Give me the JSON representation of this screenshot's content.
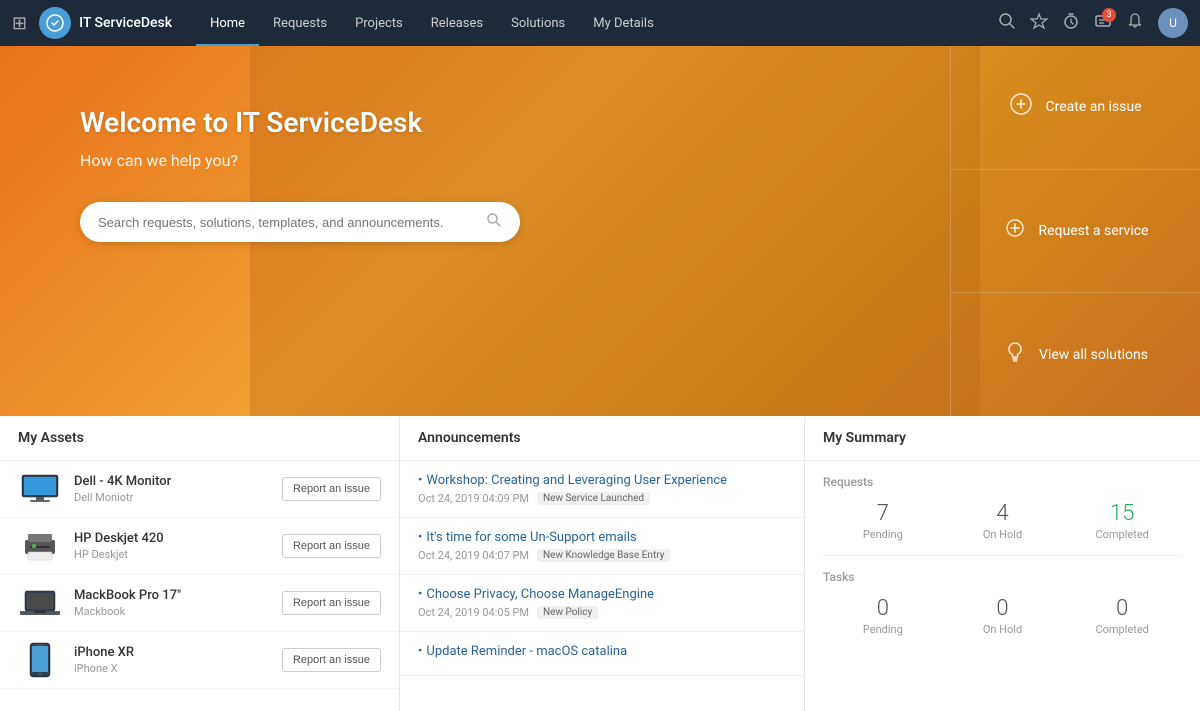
{
  "topnav": {
    "app_name": "IT ServiceDesk",
    "menu_items": [
      {
        "label": "Home",
        "active": true
      },
      {
        "label": "Requests",
        "active": false
      },
      {
        "label": "Projects",
        "active": false
      },
      {
        "label": "Releases",
        "active": false
      },
      {
        "label": "Solutions",
        "active": false
      },
      {
        "label": "My Details",
        "active": false
      }
    ],
    "notification_count": "3"
  },
  "hero": {
    "title": "Welcome to IT ServiceDesk",
    "subtitle": "How can we help you?",
    "search_placeholder": "Search requests, solutions, templates, and announcements.",
    "actions": [
      {
        "label": "Create an issue",
        "icon": "⊙"
      },
      {
        "label": "Request a service",
        "icon": "⊕"
      },
      {
        "label": "View all solutions",
        "icon": "💡"
      }
    ]
  },
  "my_assets": {
    "title": "My Assets",
    "items": [
      {
        "name": "Dell - 4K Monitor",
        "sub": "Dell Moniotr",
        "icon_type": "monitor"
      },
      {
        "name": "HP Deskjet 420",
        "sub": "HP Deskjet",
        "icon_type": "printer"
      },
      {
        "name": "MackBook Pro 17\"",
        "sub": "Mackbook",
        "icon_type": "laptop"
      },
      {
        "name": "iPhone XR",
        "sub": "iPhone X",
        "icon_type": "phone"
      }
    ],
    "report_button_label": "Report an issue"
  },
  "announcements": {
    "title": "Announcements",
    "items": [
      {
        "title": "Workshop: Creating and Leveraging User Experience",
        "date": "Oct 24, 2019 04:09 PM",
        "tag": "New Service Launched"
      },
      {
        "title": "It's time for some Un-Support emails",
        "date": "Oct 24, 2019 04:07 PM",
        "tag": "New Knowledge Base Entry"
      },
      {
        "title": "Choose Privacy, Choose ManageEngine",
        "date": "Oct 24, 2019 04:05 PM",
        "tag": "New Policy"
      },
      {
        "title": "Update Reminder - macOS catalina",
        "date": "",
        "tag": ""
      }
    ]
  },
  "my_summary": {
    "title": "My Summary",
    "requests_label": "Requests",
    "tasks_label": "Tasks",
    "requests": {
      "pending": 7,
      "on_hold": 4,
      "completed": 15
    },
    "tasks": {
      "pending": 0,
      "on_hold": 0,
      "completed": 0
    },
    "stat_labels": {
      "pending": "Pending",
      "on_hold": "On Hold",
      "completed": "Completed"
    }
  }
}
